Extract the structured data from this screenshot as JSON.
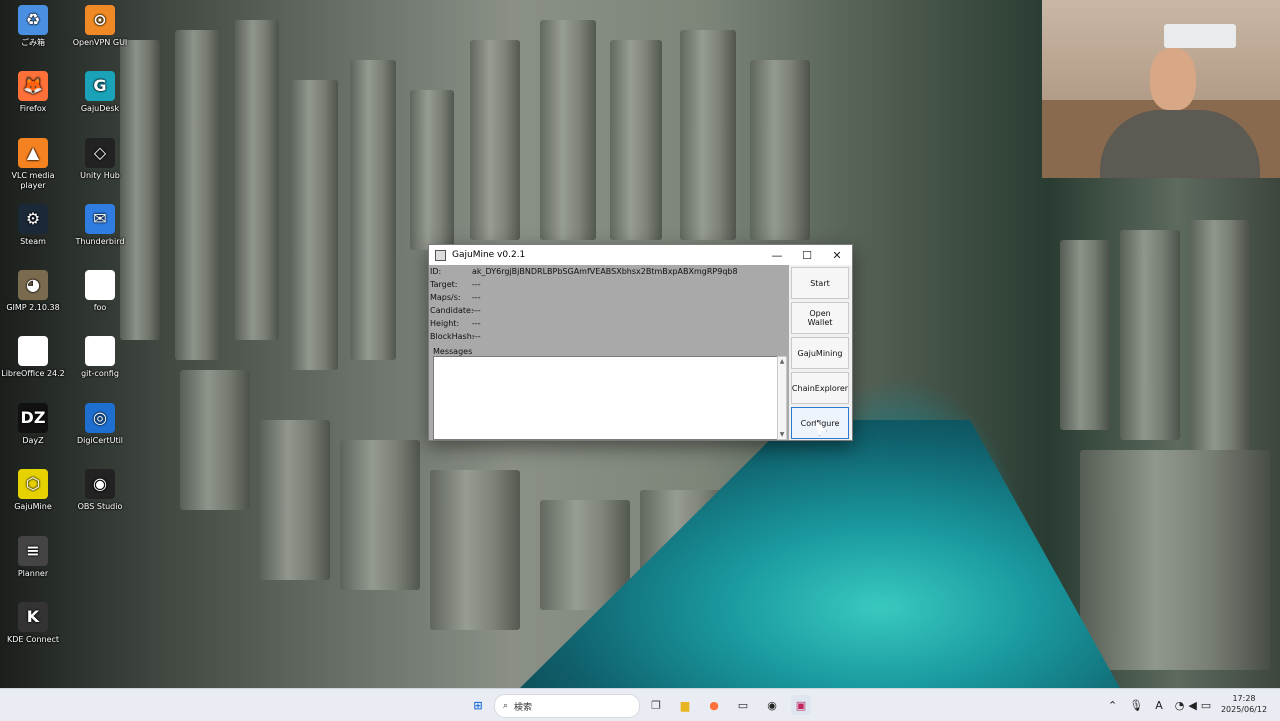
{
  "desktop": {
    "icons": [
      {
        "label": "ごみ箱",
        "glyph": "♻",
        "color": "#4a90e2"
      },
      {
        "label": "OpenVPN GUI",
        "glyph": "⊙",
        "color": "#f08a24"
      },
      {
        "label": "Firefox",
        "glyph": "🦊",
        "color": "#ff7139"
      },
      {
        "label": "GajuDesk",
        "glyph": "G",
        "color": "#1aa3b8"
      },
      {
        "label": "VLC media player",
        "glyph": "▲",
        "color": "#f58220"
      },
      {
        "label": "Unity Hub",
        "glyph": "◇",
        "color": "#222222"
      },
      {
        "label": "Steam",
        "glyph": "⚙",
        "color": "#1b2838"
      },
      {
        "label": "Thunderbird",
        "glyph": "✉",
        "color": "#2f7de1"
      },
      {
        "label": "GIMP 2.10.38",
        "glyph": "◕",
        "color": "#7a6b4f"
      },
      {
        "label": "foo",
        "glyph": "",
        "color": "#ffffff"
      },
      {
        "label": "LibreOffice 24.2",
        "glyph": "",
        "color": "#ffffff"
      },
      {
        "label": "git-config",
        "glyph": "",
        "color": "#ffffff"
      },
      {
        "label": "DayZ",
        "glyph": "DZ",
        "color": "#111111"
      },
      {
        "label": "DigiCertUtil",
        "glyph": "◎",
        "color": "#1e6fd0"
      },
      {
        "label": "GajuMine",
        "glyph": "⬡",
        "color": "#e6d200"
      },
      {
        "label": "OBS Studio",
        "glyph": "◉",
        "color": "#222222"
      },
      {
        "label": "Planner",
        "glyph": "≡",
        "color": "#444444"
      },
      {
        "label": "KDE Connect",
        "glyph": "K",
        "color": "#333333"
      }
    ]
  },
  "window": {
    "title": "GajuMine v0.2.1",
    "controls": {
      "minimize": "—",
      "maximize": "☐",
      "close": "✕"
    },
    "info": [
      {
        "label": "ID:",
        "value": "ak_DY6rgjBjBNDRLBPbSGAmfVEABSXbhsx2BtmBxpABXmgRP9qb8"
      },
      {
        "label": "Target:",
        "value": "---"
      },
      {
        "label": "Maps/s:",
        "value": "---"
      },
      {
        "label": "Candidate:",
        "value": "---"
      },
      {
        "label": "Height:",
        "value": "---"
      },
      {
        "label": "BlockHash:",
        "value": "---"
      }
    ],
    "messages_legend": "Messages",
    "messages_text": "",
    "buttons": {
      "start": "Start",
      "open_wallet": "Open Wallet",
      "gaju_mining": "GajuMining",
      "chain_explorer": "ChainExplorer",
      "configure": "Configure"
    }
  },
  "taskbar": {
    "search_placeholder": "検索",
    "time": "17:28",
    "date": "2025/06/12",
    "ime": "A"
  }
}
